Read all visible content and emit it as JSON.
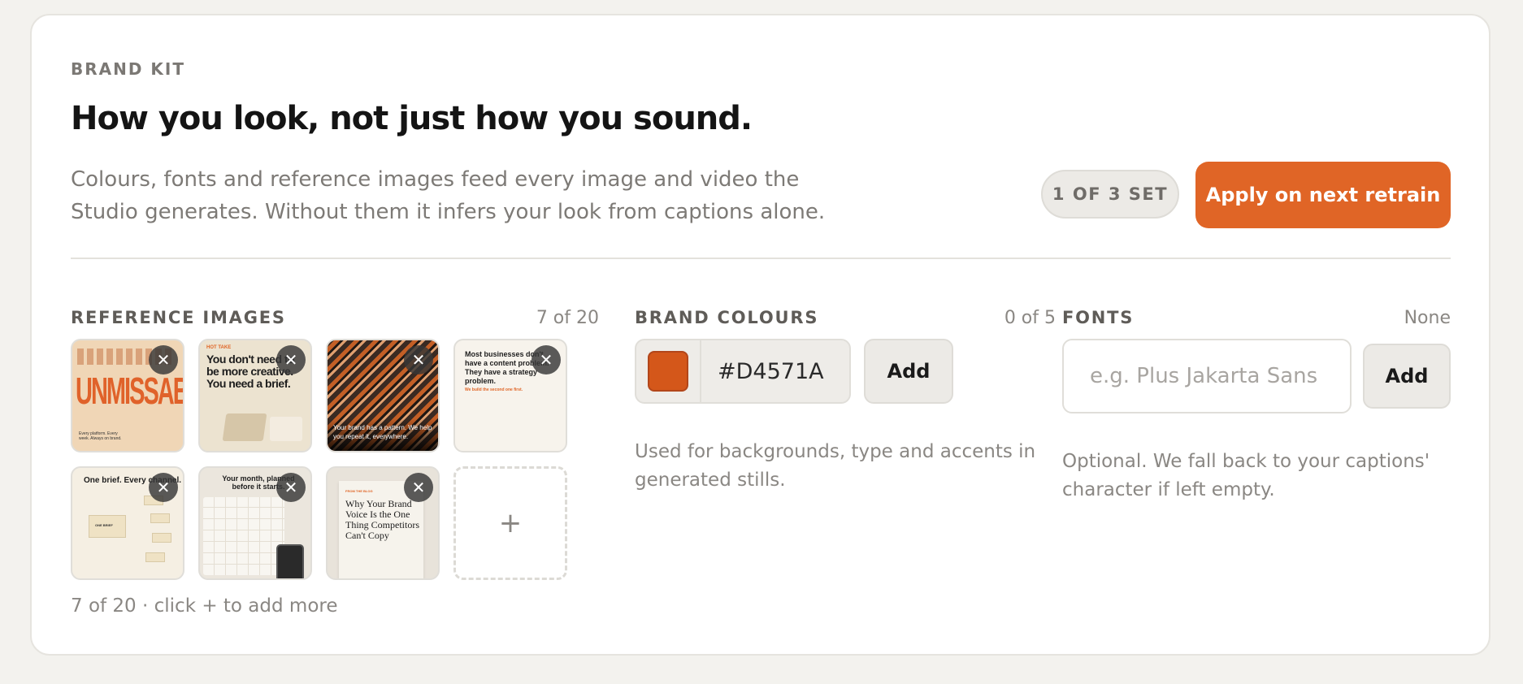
{
  "header": {
    "eyebrow": "BRAND KIT",
    "title": "How you look, not just how you sound.",
    "subtitle": "Colours, fonts and reference images feed every image and video the Studio generates. Without them it infers your look from captions alone.",
    "status": "1 OF 3 SET",
    "apply_label": "Apply on next retrain"
  },
  "reference_images": {
    "heading": "REFERENCE IMAGES",
    "count": "7 of 20",
    "remove_glyph": "✕",
    "add_glyph": "+",
    "hint": "7 of 20 · click + to add more",
    "items": [
      {
        "text": "UNMISSABLE",
        "caption": "Every platform. Every week. Always on brand."
      },
      {
        "text": "HOT TAKE",
        "caption": "You don't need to be more creative. You need a brief."
      },
      {
        "text": "Your brand has a pattern. We help you repeat it, everywhere."
      },
      {
        "text": "Most businesses don't have a content problem. They have a strategy problem.",
        "caption": "We build the second one first."
      },
      {
        "text": "One brief. Every channel.",
        "caption": "ONE BRIEF"
      },
      {
        "text": "Your month, planned before it starts."
      },
      {
        "text": "FROM THE BLOG",
        "caption": "Why Your Brand Voice Is the One Thing Competitors Can't Copy"
      }
    ]
  },
  "brand_colours": {
    "heading": "BRAND COLOURS",
    "count": "0 of 5",
    "value": "#D4571A",
    "swatch_color": "#D4571A",
    "add_label": "Add",
    "hint": "Used for backgrounds, type and accents in generated stills."
  },
  "fonts": {
    "heading": "FONTS",
    "count": "None",
    "placeholder": "e.g. Plus Jakarta Sans",
    "add_label": "Add",
    "hint": "Optional. We fall back to your captions' character if left empty."
  },
  "colors": {
    "accent": "#E06526",
    "background": "#F3F2EE"
  }
}
